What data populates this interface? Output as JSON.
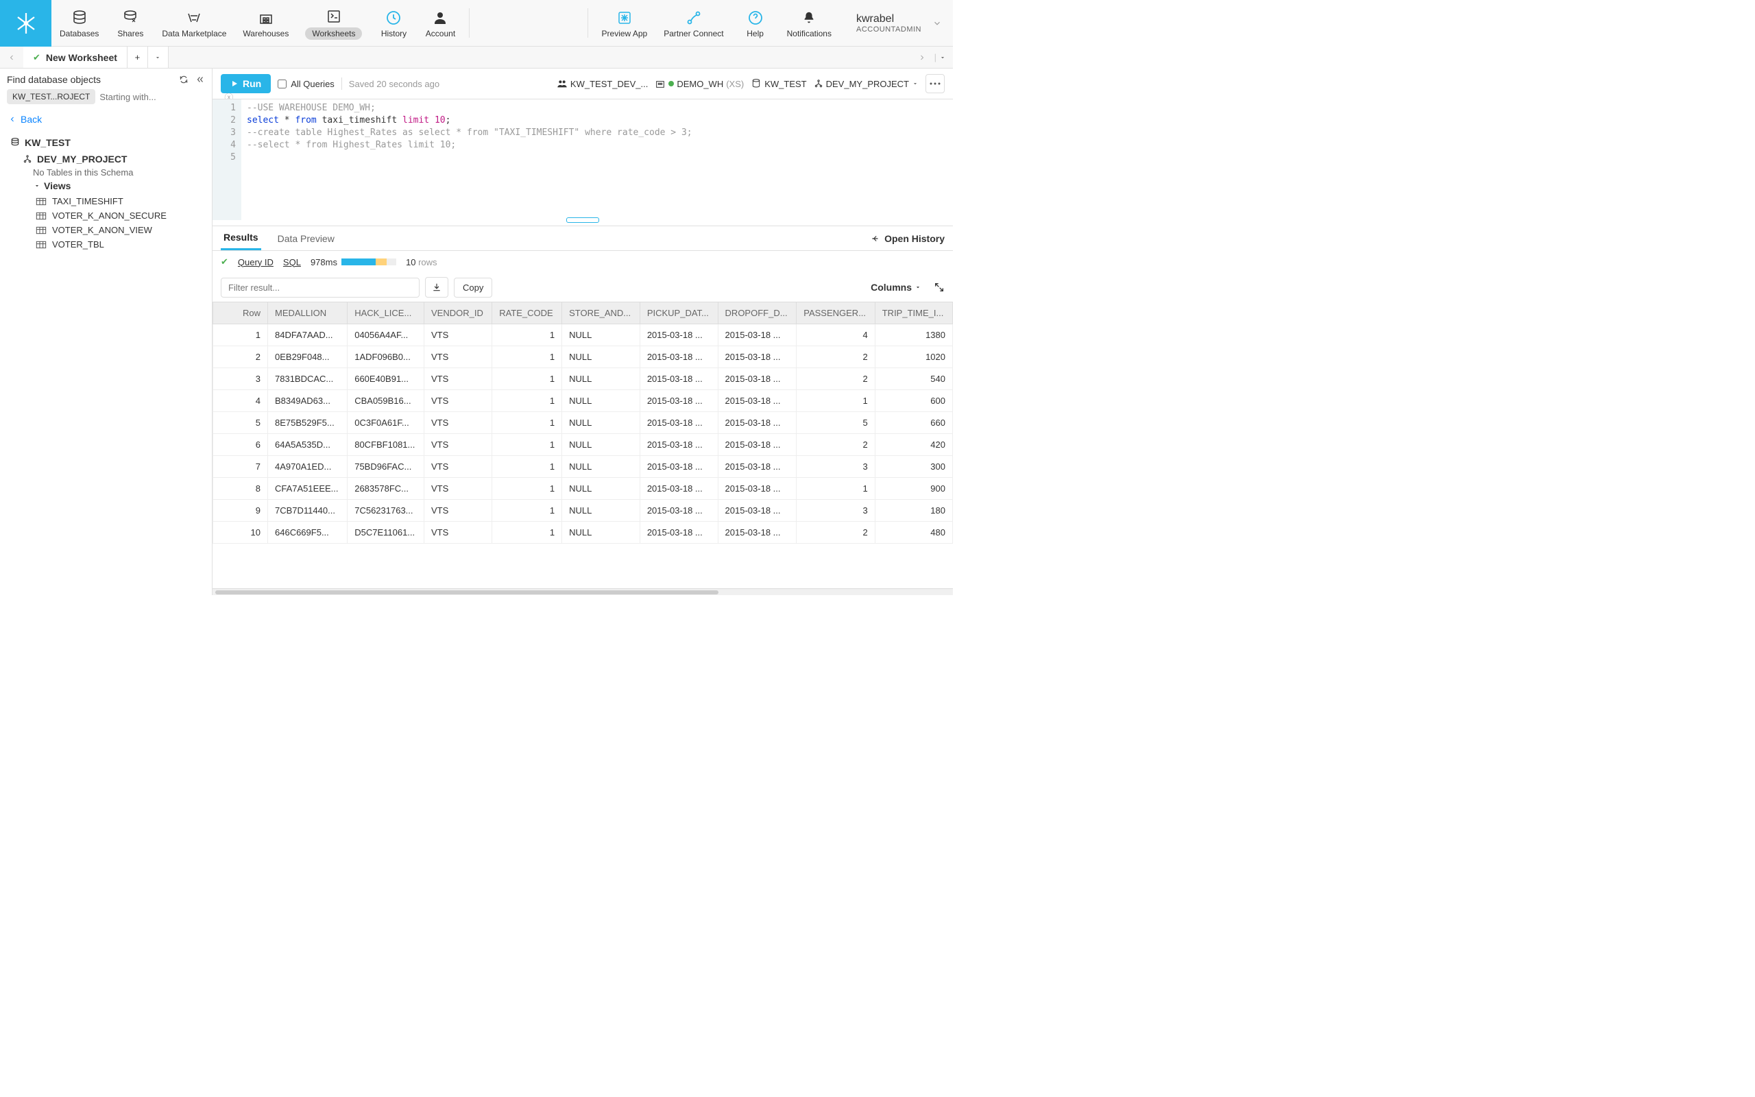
{
  "nav": {
    "items": [
      {
        "label": "Databases"
      },
      {
        "label": "Shares"
      },
      {
        "label": "Data Marketplace"
      },
      {
        "label": "Warehouses"
      },
      {
        "label": "Worksheets"
      },
      {
        "label": "History"
      },
      {
        "label": "Account"
      }
    ],
    "right_items": [
      {
        "label": "Preview App"
      },
      {
        "label": "Partner Connect"
      },
      {
        "label": "Help"
      },
      {
        "label": "Notifications"
      }
    ],
    "username": "kwrabel",
    "role": "ACCOUNTADMIN"
  },
  "tabs": {
    "current": "New Worksheet"
  },
  "sidebar": {
    "search_label": "Find database objects",
    "pill": "KW_TEST...ROJECT",
    "placeholder": "Starting with...",
    "back": "Back",
    "db": "KW_TEST",
    "schema": "DEV_MY_PROJECT",
    "no_tables": "No Tables in this Schema",
    "views_label": "Views",
    "views": [
      "TAXI_TIMESHIFT",
      "VOTER_K_ANON_SECURE",
      "VOTER_K_ANON_VIEW",
      "VOTER_TBL"
    ]
  },
  "toolbar": {
    "run": "Run",
    "all_queries": "All Queries",
    "saved": "Saved 20 seconds ago",
    "role": "KW_TEST_DEV_...",
    "warehouse": "DEMO_WH",
    "wh_size": "(XS)",
    "database": "KW_TEST",
    "schema": "DEV_MY_PROJECT"
  },
  "editor": {
    "lines": [
      {
        "n": 1,
        "type": "cmt",
        "text": "--USE WAREHOUSE DEMO_WH;"
      },
      {
        "n": 2,
        "type": "sql"
      },
      {
        "n": 3,
        "type": "cmt",
        "text": "--create table Highest_Rates as select * from \"TAXI_TIMESHIFT\" where rate_code > 3;"
      },
      {
        "n": 4,
        "type": "cmt",
        "text": "--select * from Highest_Rates limit 10;"
      },
      {
        "n": 5,
        "type": "blank",
        "text": ""
      }
    ],
    "sql_select": "select",
    "sql_star": " * ",
    "sql_from": "from",
    "sql_table": " taxi_timeshift ",
    "sql_limit": "limit",
    "sql_num": " 10",
    "sql_semi": ";"
  },
  "results": {
    "tab_results": "Results",
    "tab_preview": "Data Preview",
    "open_history": "Open History",
    "query_id": "Query ID",
    "sql_link": "SQL",
    "timing": "978ms",
    "rows_count": "10",
    "rows_label": "rows",
    "filter_placeholder": "Filter result...",
    "copy": "Copy",
    "columns_btn": "Columns",
    "columns": [
      "Row",
      "MEDALLION",
      "HACK_LICE...",
      "VENDOR_ID",
      "RATE_CODE",
      "STORE_AND...",
      "PICKUP_DAT...",
      "DROPOFF_D...",
      "PASSENGER...",
      "TRIP_TIME_I..."
    ],
    "rows": [
      [
        "1",
        "84DFA7AAD...",
        "04056A4AF...",
        "VTS",
        "1",
        "NULL",
        "2015-03-18 ...",
        "2015-03-18 ...",
        "4",
        "1380"
      ],
      [
        "2",
        "0EB29F048...",
        "1ADF096B0...",
        "VTS",
        "1",
        "NULL",
        "2015-03-18 ...",
        "2015-03-18 ...",
        "2",
        "1020"
      ],
      [
        "3",
        "7831BDCAC...",
        "660E40B91...",
        "VTS",
        "1",
        "NULL",
        "2015-03-18 ...",
        "2015-03-18 ...",
        "2",
        "540"
      ],
      [
        "4",
        "B8349AD63...",
        "CBA059B16...",
        "VTS",
        "1",
        "NULL",
        "2015-03-18 ...",
        "2015-03-18 ...",
        "1",
        "600"
      ],
      [
        "5",
        "8E75B529F5...",
        "0C3F0A61F...",
        "VTS",
        "1",
        "NULL",
        "2015-03-18 ...",
        "2015-03-18 ...",
        "5",
        "660"
      ],
      [
        "6",
        "64A5A535D...",
        "80CFBF1081...",
        "VTS",
        "1",
        "NULL",
        "2015-03-18 ...",
        "2015-03-18 ...",
        "2",
        "420"
      ],
      [
        "7",
        "4A970A1ED...",
        "75BD96FAC...",
        "VTS",
        "1",
        "NULL",
        "2015-03-18 ...",
        "2015-03-18 ...",
        "3",
        "300"
      ],
      [
        "8",
        "CFA7A51EEE...",
        "2683578FC...",
        "VTS",
        "1",
        "NULL",
        "2015-03-18 ...",
        "2015-03-18 ...",
        "1",
        "900"
      ],
      [
        "9",
        "7CB7D11440...",
        "7C56231763...",
        "VTS",
        "1",
        "NULL",
        "2015-03-18 ...",
        "2015-03-18 ...",
        "3",
        "180"
      ],
      [
        "10",
        "646C669F5...",
        "D5C7E11061...",
        "VTS",
        "1",
        "NULL",
        "2015-03-18 ...",
        "2015-03-18 ...",
        "2",
        "480"
      ]
    ]
  }
}
